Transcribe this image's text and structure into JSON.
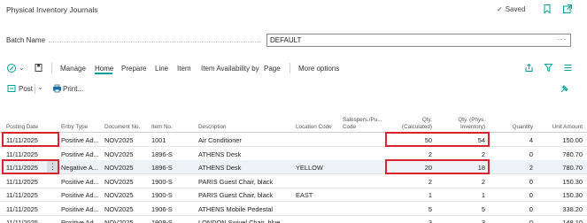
{
  "header": {
    "title": "Physical Inventory Journals",
    "saved_label": "Saved"
  },
  "batch": {
    "label": "Batch Name",
    "value": "DEFAULT",
    "ellipsis": "···"
  },
  "actions": {
    "manage": "Manage",
    "home": "Home",
    "prepare": "Prepare",
    "line": "Line",
    "item": "Item",
    "item_availability": "Item Availability by",
    "page": "Page",
    "more_options": "More options",
    "post": "Post",
    "print": "Print..."
  },
  "columns": {
    "posting_date": "Posting Date",
    "entry_type": "Entry Type",
    "document_no": "Document No.",
    "item_no": "Item No.",
    "description": "Description",
    "location_code": "Location Code",
    "salespers_1": "Salespers./Pu...",
    "salespers_2": "Code",
    "qty_calc_1": "Qty.",
    "qty_calc_2": "(Calculated)",
    "qty_phys_1": "Qty. (Phys.",
    "qty_phys_2": "Inventory)",
    "quantity": "Quantity",
    "unit_amount": "Unit Amount"
  },
  "rows": [
    {
      "date": "11/11/2025",
      "entry": "Positive Ad...",
      "doc": "NOV2025",
      "item": "1001",
      "desc": "Air Conditioner",
      "loc": "",
      "calc": "50",
      "phys": "54",
      "qty": "4",
      "amount": "150.00"
    },
    {
      "date": "11/11/2025",
      "entry": "Positive Ad...",
      "doc": "NOV2025",
      "item": "1896-S",
      "desc": "ATHENS Desk",
      "loc": "",
      "calc": "2",
      "phys": "2",
      "qty": "0",
      "amount": "780.70"
    },
    {
      "date": "11/11/2025",
      "entry": "Negative A...",
      "doc": "NOV2025",
      "item": "1896-S",
      "desc": "ATHENS Desk",
      "loc": "YELLOW",
      "calc": "20",
      "phys": "18",
      "qty": "2",
      "amount": "780.70"
    },
    {
      "date": "11/11/2025",
      "entry": "Positive Ad...",
      "doc": "NOV2025",
      "item": "1900-S",
      "desc": "PARIS Guest Chair, black",
      "loc": "",
      "calc": "2",
      "phys": "2",
      "qty": "0",
      "amount": "150.30"
    },
    {
      "date": "11/11/2025",
      "entry": "Positive Ad...",
      "doc": "NOV2025",
      "item": "1900-S",
      "desc": "PARIS Guest Chair, black",
      "loc": "EAST",
      "calc": "1",
      "phys": "1",
      "qty": "0",
      "amount": "150.30"
    },
    {
      "date": "11/11/2025",
      "entry": "Positive Ad...",
      "doc": "NOV2025",
      "item": "1906-S",
      "desc": "ATHENS Mobile Pedestal",
      "loc": "",
      "calc": "5",
      "phys": "5",
      "qty": "0",
      "amount": "338.20"
    },
    {
      "date": "11/11/2025",
      "entry": "Positive Ad...",
      "doc": "NOV2025",
      "item": "1908-S",
      "desc": "LONDON Swivel Chair, blue",
      "loc": "",
      "calc": "3",
      "phys": "3",
      "qty": "0",
      "amount": "148.10"
    }
  ],
  "colors": {
    "accent": "#00a19a",
    "highlight": "#d9232e",
    "selected_row": "#eef2f7"
  },
  "icons": [
    "check-icon",
    "bookmark-icon",
    "open-in-new-icon",
    "collapse-icon",
    "edit-mode-icon",
    "new-page-icon",
    "share-icon",
    "filter-icon",
    "list-view-icon",
    "post-icon",
    "chevron-down-icon",
    "printer-icon",
    "pin-icon",
    "more-icon"
  ]
}
